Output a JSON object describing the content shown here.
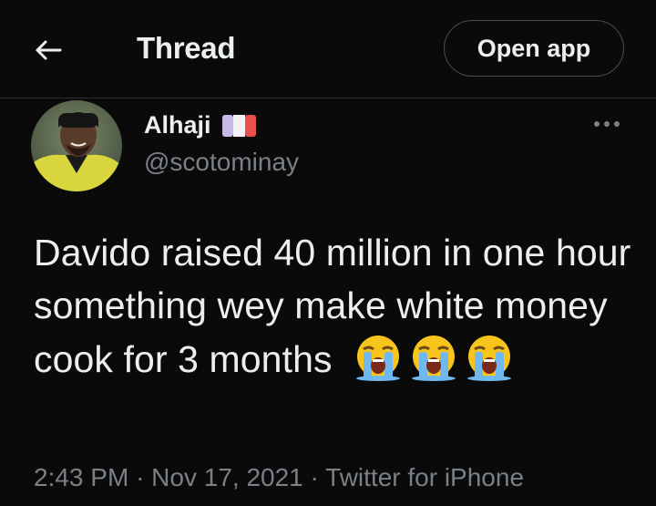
{
  "header": {
    "title": "Thread",
    "open_app_label": "Open app",
    "back_icon": "arrow-left-icon"
  },
  "tweet": {
    "display_name": "Alhaji",
    "flag": "flag-emoji",
    "handle": "@scotominay",
    "more_icon": "more-horizontal-icon",
    "text": "Davido raised 40 million in one hour something wey make white money cook for 3 months",
    "emojis": [
      "loudly-crying-face",
      "loudly-crying-face",
      "loudly-crying-face"
    ],
    "time": "2:43 PM",
    "separator": "·",
    "date": "Nov 17, 2021",
    "source": "Twitter for iPhone"
  },
  "colors": {
    "background": "#0a0a0a",
    "text": "#eceff1",
    "secondary": "#7a8087",
    "border": "#2a2d31",
    "avatar_shirt": "#d8d63c"
  }
}
